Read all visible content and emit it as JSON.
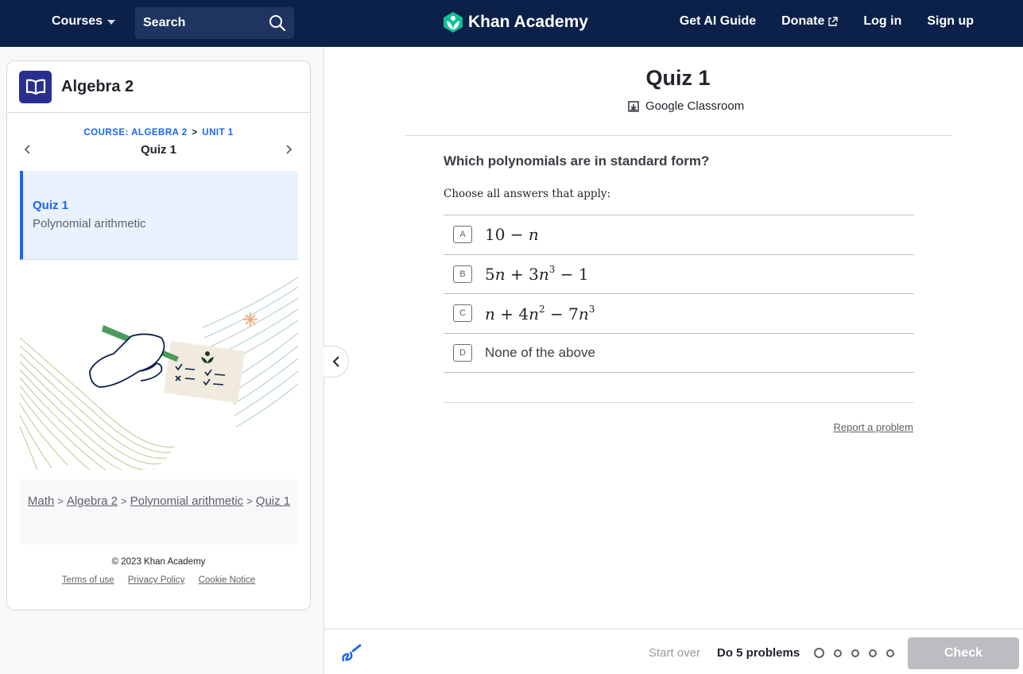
{
  "nav": {
    "courses_label": "Courses",
    "search_label": "Search",
    "brand": "Khan Academy",
    "links": [
      "Get AI Guide",
      "Donate",
      "Log in",
      "Sign up"
    ]
  },
  "sidebar": {
    "course_title": "Algebra 2",
    "crumb_course": "COURSE: ALGEBRA 2",
    "crumb_sep": ">",
    "crumb_unit": "UNIT 1",
    "current_title": "Quiz 1",
    "card_title": "Quiz 1",
    "card_subtitle": "Polynomial arithmetic",
    "breadcrumb": {
      "math": "Math",
      "algebra": "Algebra 2",
      "poly": "Polynomial arithmetic",
      "quiz": "Quiz 1",
      "sep": ">"
    },
    "copyright": "© 2023 Khan Academy",
    "terms": "Terms of use",
    "privacy": "Privacy Policy",
    "cookie": "Cookie Notice"
  },
  "main": {
    "title": "Quiz 1",
    "classroom": "Google Classroom",
    "question": "Which polynomials are in standard form?",
    "instructions": "Choose all answers that apply:",
    "letters": [
      "A",
      "B",
      "C",
      "D"
    ],
    "choice_d": "None of the above",
    "report": "Report a problem"
  },
  "bottom": {
    "start_over": "Start over",
    "do_problems": "Do 5 problems",
    "check": "Check"
  },
  "colors": {
    "nav_bg": "#0b2149",
    "accent": "#1865f2",
    "brand_green": "#14bf96"
  }
}
